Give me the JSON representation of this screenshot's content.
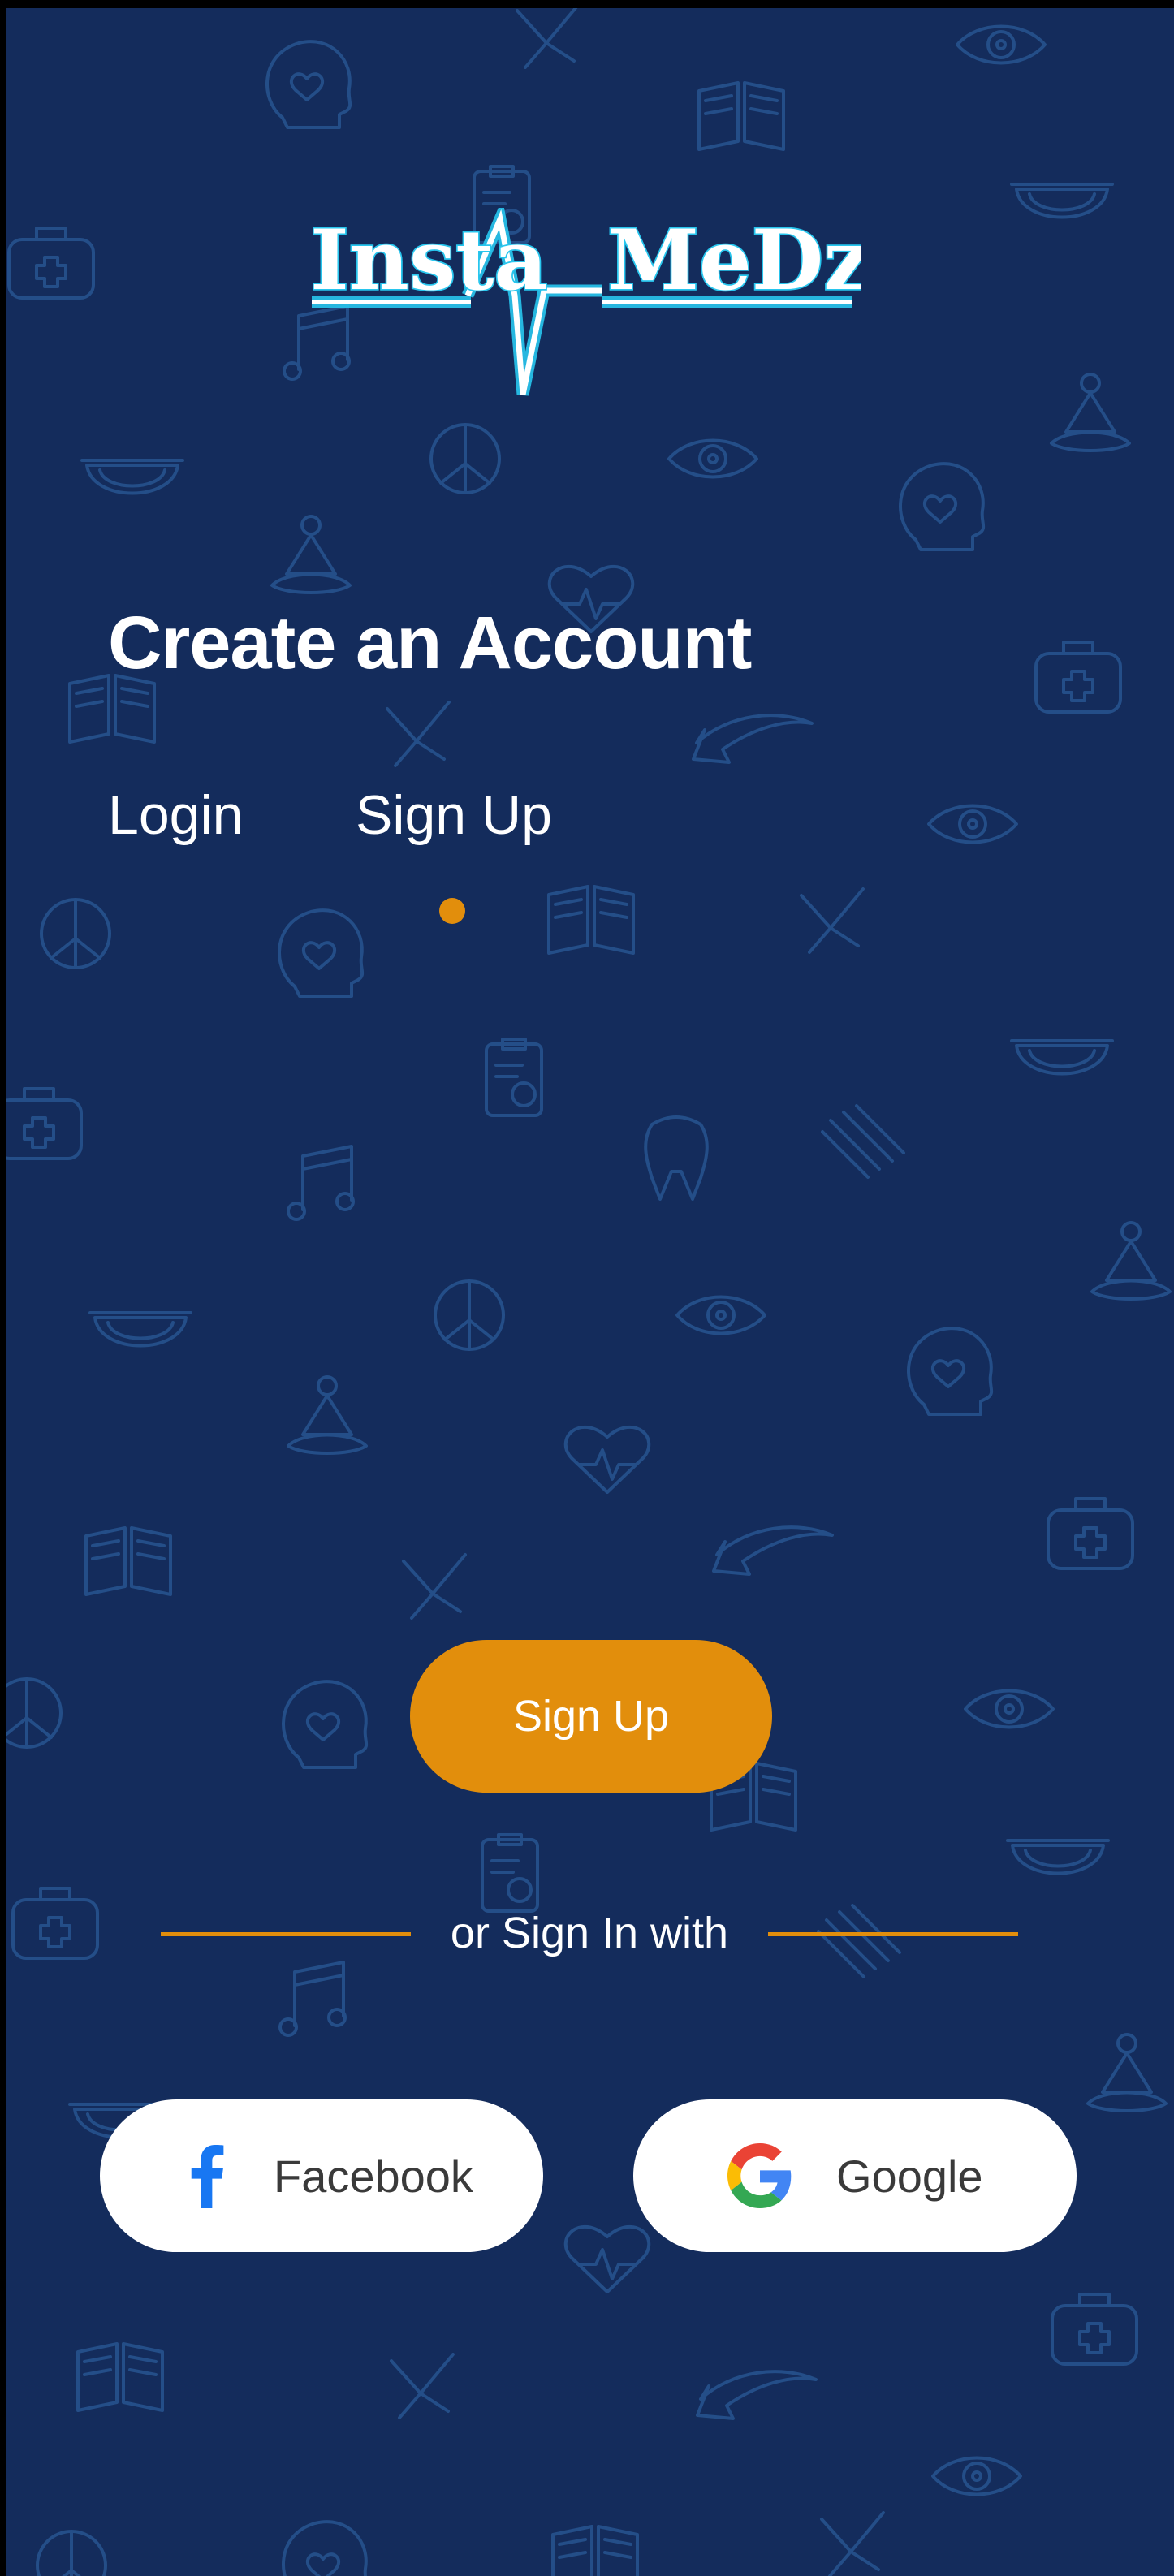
{
  "app": {
    "logo_left": "Insta",
    "logo_right": "MeDz"
  },
  "page": {
    "title": "Create an Account"
  },
  "tabs": {
    "login_label": "Login",
    "signup_label": "Sign Up",
    "active": "Sign Up"
  },
  "actions": {
    "signup_button_label": "Sign Up",
    "divider_text": "or Sign In with"
  },
  "social": {
    "facebook_label": "Facebook",
    "google_label": "Google"
  },
  "colors": {
    "background": "#142c5c",
    "accent": "#e28e0c",
    "logo_glow": "#28c6ee",
    "doodle": "#2a5a97",
    "facebook_blue": "#1877f2"
  },
  "icons": {
    "background_pattern": [
      "heart-head-icon",
      "book-icon",
      "eye-icon",
      "bowl-icon",
      "medical-bag-icon",
      "peace-icon",
      "meditation-icon",
      "heart-icon",
      "arrow-icon",
      "tooth-icon",
      "clipboard-icon",
      "music-note-icon"
    ],
    "facebook": "facebook-icon",
    "google": "google-icon"
  }
}
